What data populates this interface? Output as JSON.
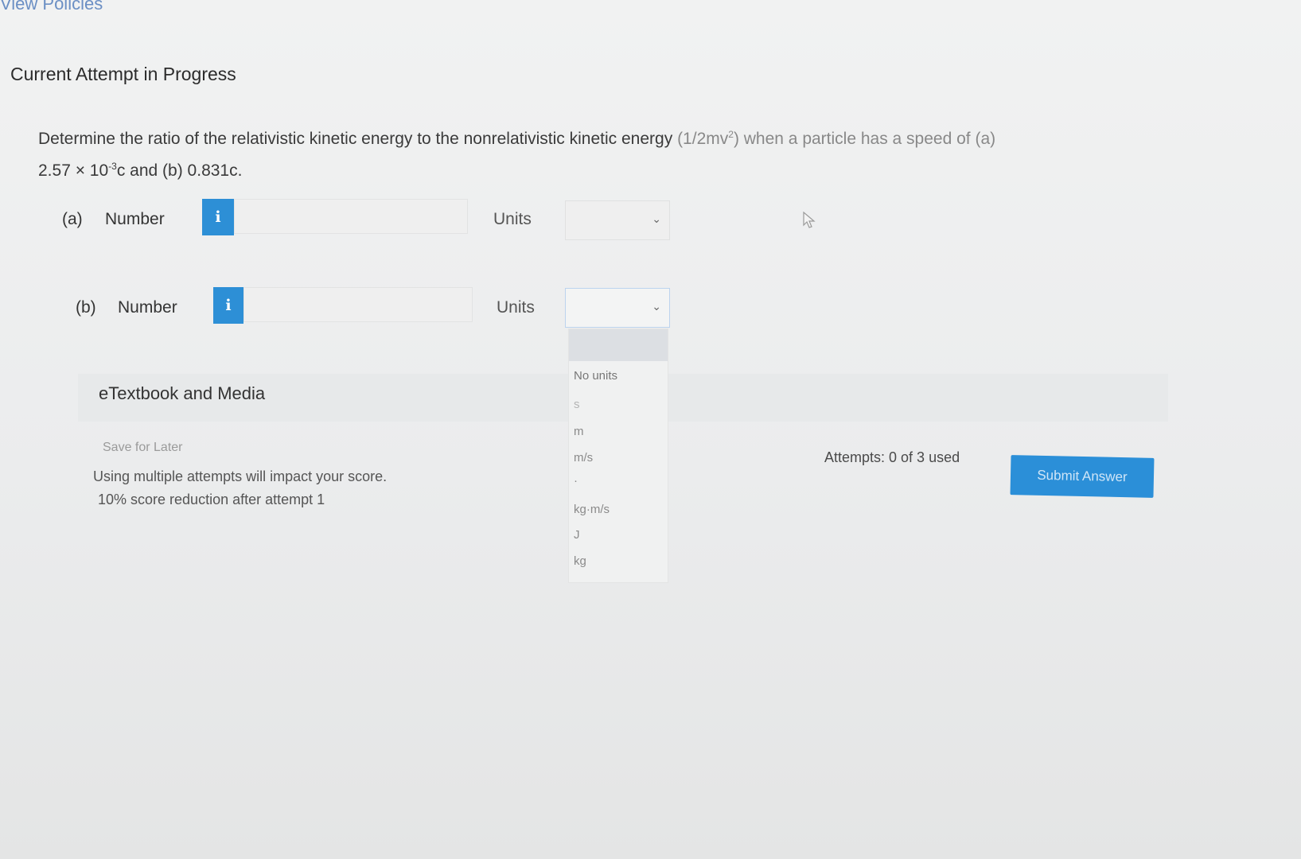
{
  "header": {
    "link": "View Policies",
    "title": "Current Attempt in Progress"
  },
  "question": {
    "text_main": "Determine the ratio of the relativistic kinetic energy to the nonrelativistic kinetic energy",
    "text_formula": "(1/2mv",
    "text_formula_exp": "2",
    "text_tail": ") when a particle has a speed of (a)",
    "line2_prefix": "2.57 × 10",
    "line2_exp": "-3",
    "line2_suffix": "c and (b) 0.831c."
  },
  "parts": [
    {
      "label": "(a)",
      "number_label": "Number",
      "info_icon": "info-icon",
      "value": "",
      "units_label": "Units",
      "units_value": ""
    },
    {
      "label": "(b)",
      "number_label": "Number",
      "info_icon": "info-icon",
      "value": "",
      "units_label": "Units",
      "units_value": ""
    }
  ],
  "units_dropdown": {
    "open": true,
    "options": [
      "No units",
      "s",
      "m",
      "m/s",
      "·",
      "kg·m/s",
      "J",
      "kg"
    ]
  },
  "etextbook": {
    "label": "eTextbook and Media"
  },
  "footer": {
    "save_later": "Save for Later",
    "notice_line1": "Using multiple attempts will impact your score.",
    "notice_line2": "10% score reduction after attempt 1",
    "attempts": "Attempts: 0 of 3 used",
    "submit": "Submit Answer"
  },
  "colors": {
    "accent": "#2d8fd6",
    "link": "#6b8fc4"
  }
}
